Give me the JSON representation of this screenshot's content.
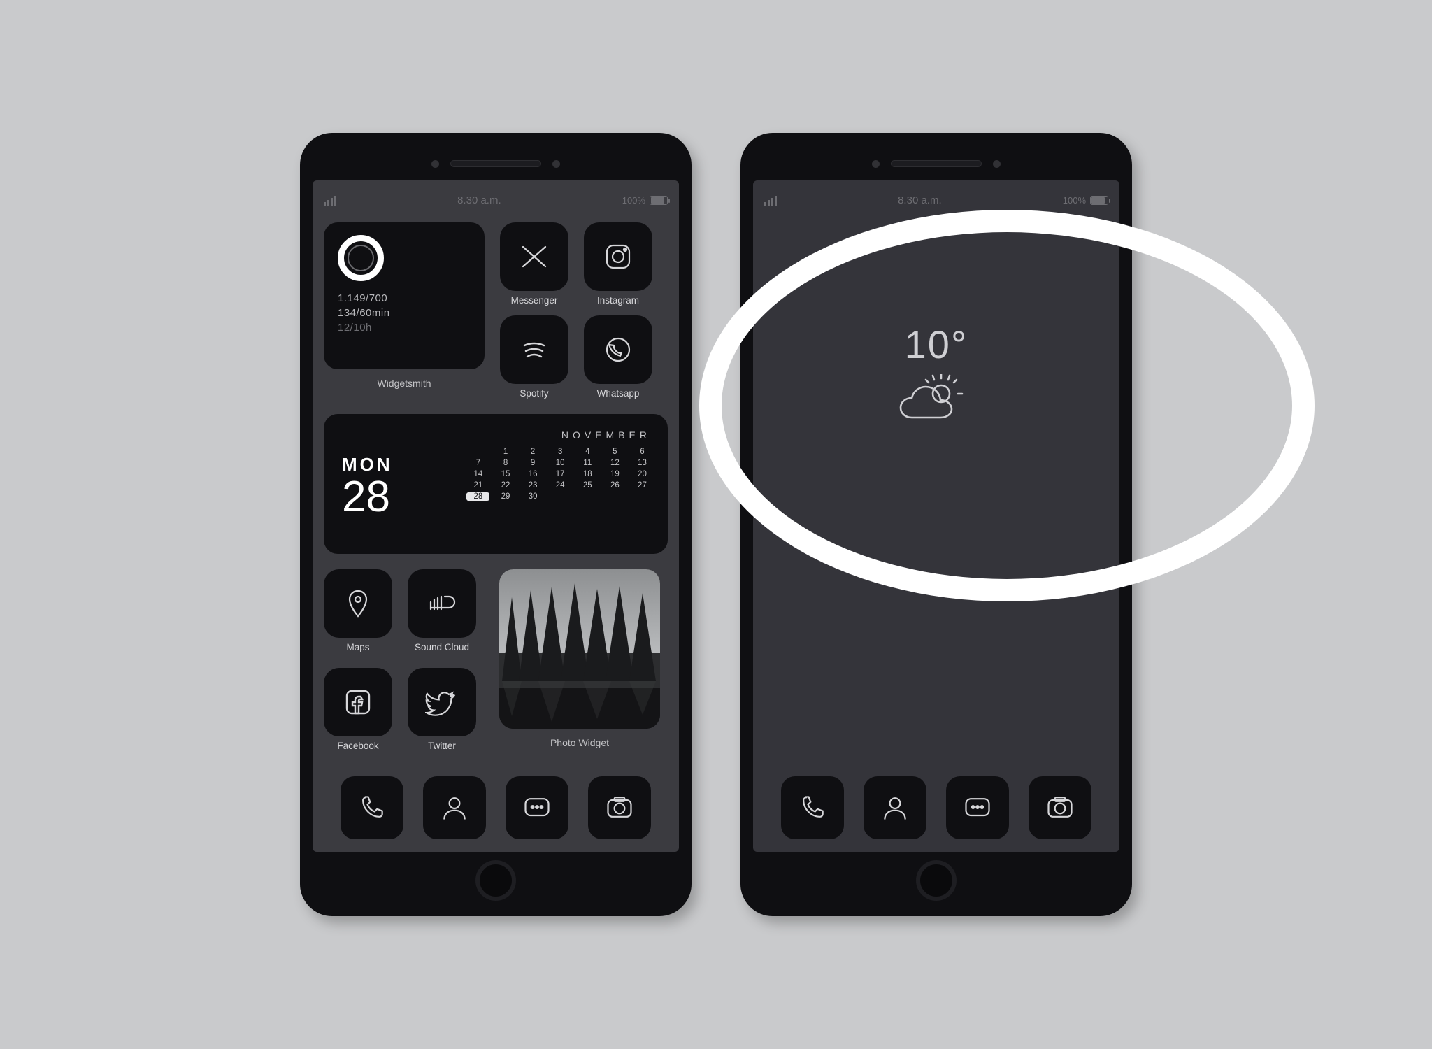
{
  "statusbar": {
    "time": "8.30 a.m.",
    "battery_pct": "100%"
  },
  "phone1": {
    "widgetsmith": {
      "label": "Widgetsmith",
      "line1": "1.149/700",
      "line2": "134/60min",
      "line3": "12/10h"
    },
    "apps_right_top": [
      {
        "label": "Messenger"
      },
      {
        "label": "Instagram"
      },
      {
        "label": "Spotify"
      },
      {
        "label": "Whatsapp"
      }
    ],
    "calendar": {
      "dow": "MON",
      "date": "28",
      "month": "NOVEMBER",
      "days": [
        "1",
        "2",
        "3",
        "4",
        "5",
        "6",
        "7",
        "8",
        "9",
        "10",
        "11",
        "12",
        "13",
        "14",
        "15",
        "16",
        "17",
        "18",
        "19",
        "20",
        "21",
        "22",
        "23",
        "24",
        "25",
        "26",
        "27",
        "28",
        "29",
        "30"
      ],
      "highlight_index": 27
    },
    "apps_bottom_left": [
      {
        "label": "Maps"
      },
      {
        "label": "Sound Cloud"
      },
      {
        "label": "Facebook"
      },
      {
        "label": "Twitter"
      }
    ],
    "photo_widget_label": "Photo Widget"
  },
  "phone2": {
    "weather": {
      "temp": "10°"
    }
  }
}
